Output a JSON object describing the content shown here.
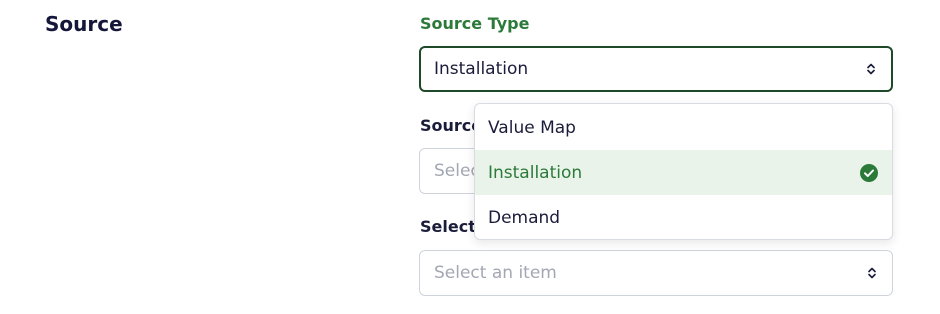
{
  "section": {
    "title": "Source"
  },
  "fields": {
    "source_type": {
      "label": "Source Type",
      "value": "Installation"
    },
    "source": {
      "label": "Source",
      "placeholder": "Select an item"
    },
    "select_item": {
      "label": "Select",
      "placeholder": "Select an item"
    }
  },
  "dropdown": {
    "options": [
      {
        "label": "Value Map",
        "selected": false
      },
      {
        "label": "Installation",
        "selected": true
      },
      {
        "label": "Demand",
        "selected": false
      }
    ]
  },
  "colors": {
    "accent": "#2c7a3a",
    "selected_bg": "#e9f3ea",
    "text": "#1b1c3a",
    "placeholder": "#a3a7b3"
  },
  "icons": {
    "caret": "chevron-up-down-icon",
    "check": "check-circle-icon"
  }
}
